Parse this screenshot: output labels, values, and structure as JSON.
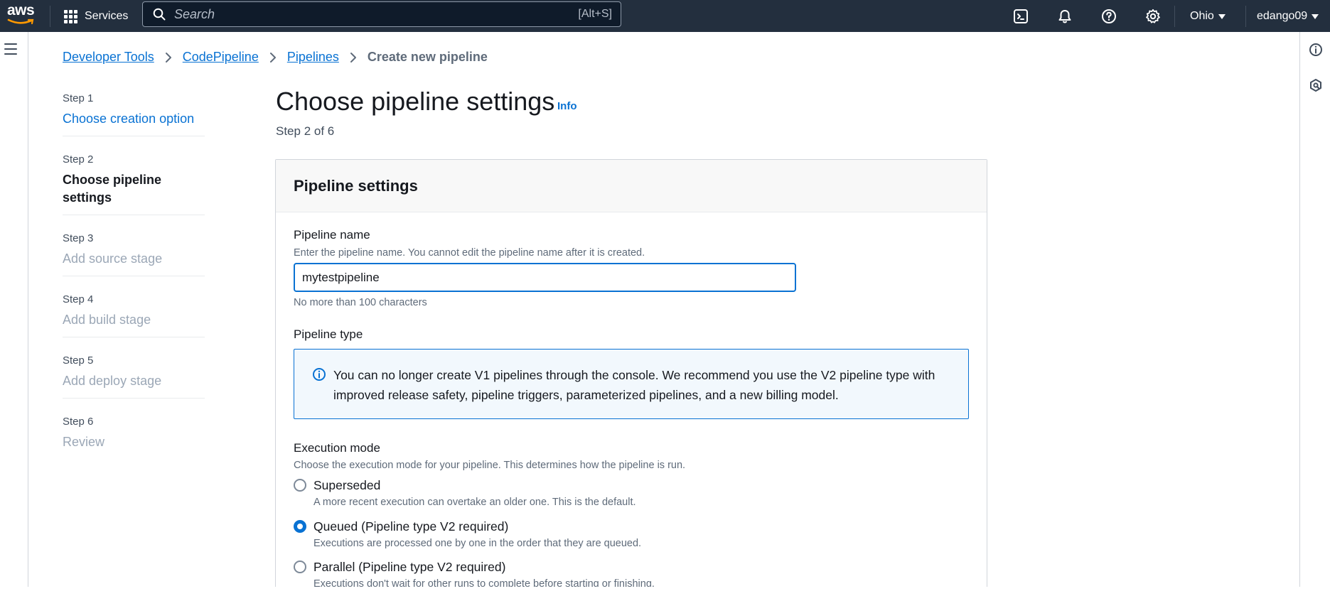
{
  "topnav": {
    "logo_text": "aws",
    "services_label": "Services",
    "search_placeholder": "Search",
    "search_shortcut": "[Alt+S]",
    "region": "Ohio",
    "account": "edango09",
    "icons": [
      "cloudshell-icon",
      "bell-icon",
      "help-icon",
      "settings-icon"
    ]
  },
  "breadcrumb": {
    "items": [
      "Developer Tools",
      "CodePipeline",
      "Pipelines"
    ],
    "current": "Create new pipeline"
  },
  "steps": [
    {
      "num": "Step 1",
      "title": "Choose creation option",
      "state": "link"
    },
    {
      "num": "Step 2",
      "title": "Choose pipeline settings",
      "state": "current"
    },
    {
      "num": "Step 3",
      "title": "Add source stage",
      "state": "disabled"
    },
    {
      "num": "Step 4",
      "title": "Add build stage",
      "state": "disabled"
    },
    {
      "num": "Step 5",
      "title": "Add deploy stage",
      "state": "disabled"
    },
    {
      "num": "Step 6",
      "title": "Review",
      "state": "disabled"
    }
  ],
  "header": {
    "title": "Choose pipeline settings",
    "info": "Info",
    "subtitle": "Step 2 of 6"
  },
  "settings": {
    "heading": "Pipeline settings",
    "name_label": "Pipeline name",
    "name_desc": "Enter the pipeline name. You cannot edit the pipeline name after it is created.",
    "name_value": "mytestpipeline",
    "name_constraint": "No more than 100 characters",
    "type_label": "Pipeline type",
    "type_alert": "You can no longer create V1 pipelines through the console. We recommend you use the V2 pipeline type with improved release safety, pipeline triggers, parameterized pipelines, and a new billing model.",
    "exec_label": "Execution mode",
    "exec_desc": "Choose the execution mode for your pipeline. This determines how the pipeline is run.",
    "modes": [
      {
        "label": "Superseded",
        "desc": "A more recent execution can overtake an older one. This is the default.",
        "checked": false
      },
      {
        "label": "Queued (Pipeline type V2 required)",
        "desc": "Executions are processed one by one in the order that they are queued.",
        "checked": true
      },
      {
        "label": "Parallel (Pipeline type V2 required)",
        "desc": "Executions don't wait for other runs to complete before starting or finishing.",
        "checked": false
      }
    ]
  },
  "colors": {
    "nav_bg": "#232f3e",
    "link": "#0972d3",
    "alert_bg": "#f2f8fd"
  }
}
